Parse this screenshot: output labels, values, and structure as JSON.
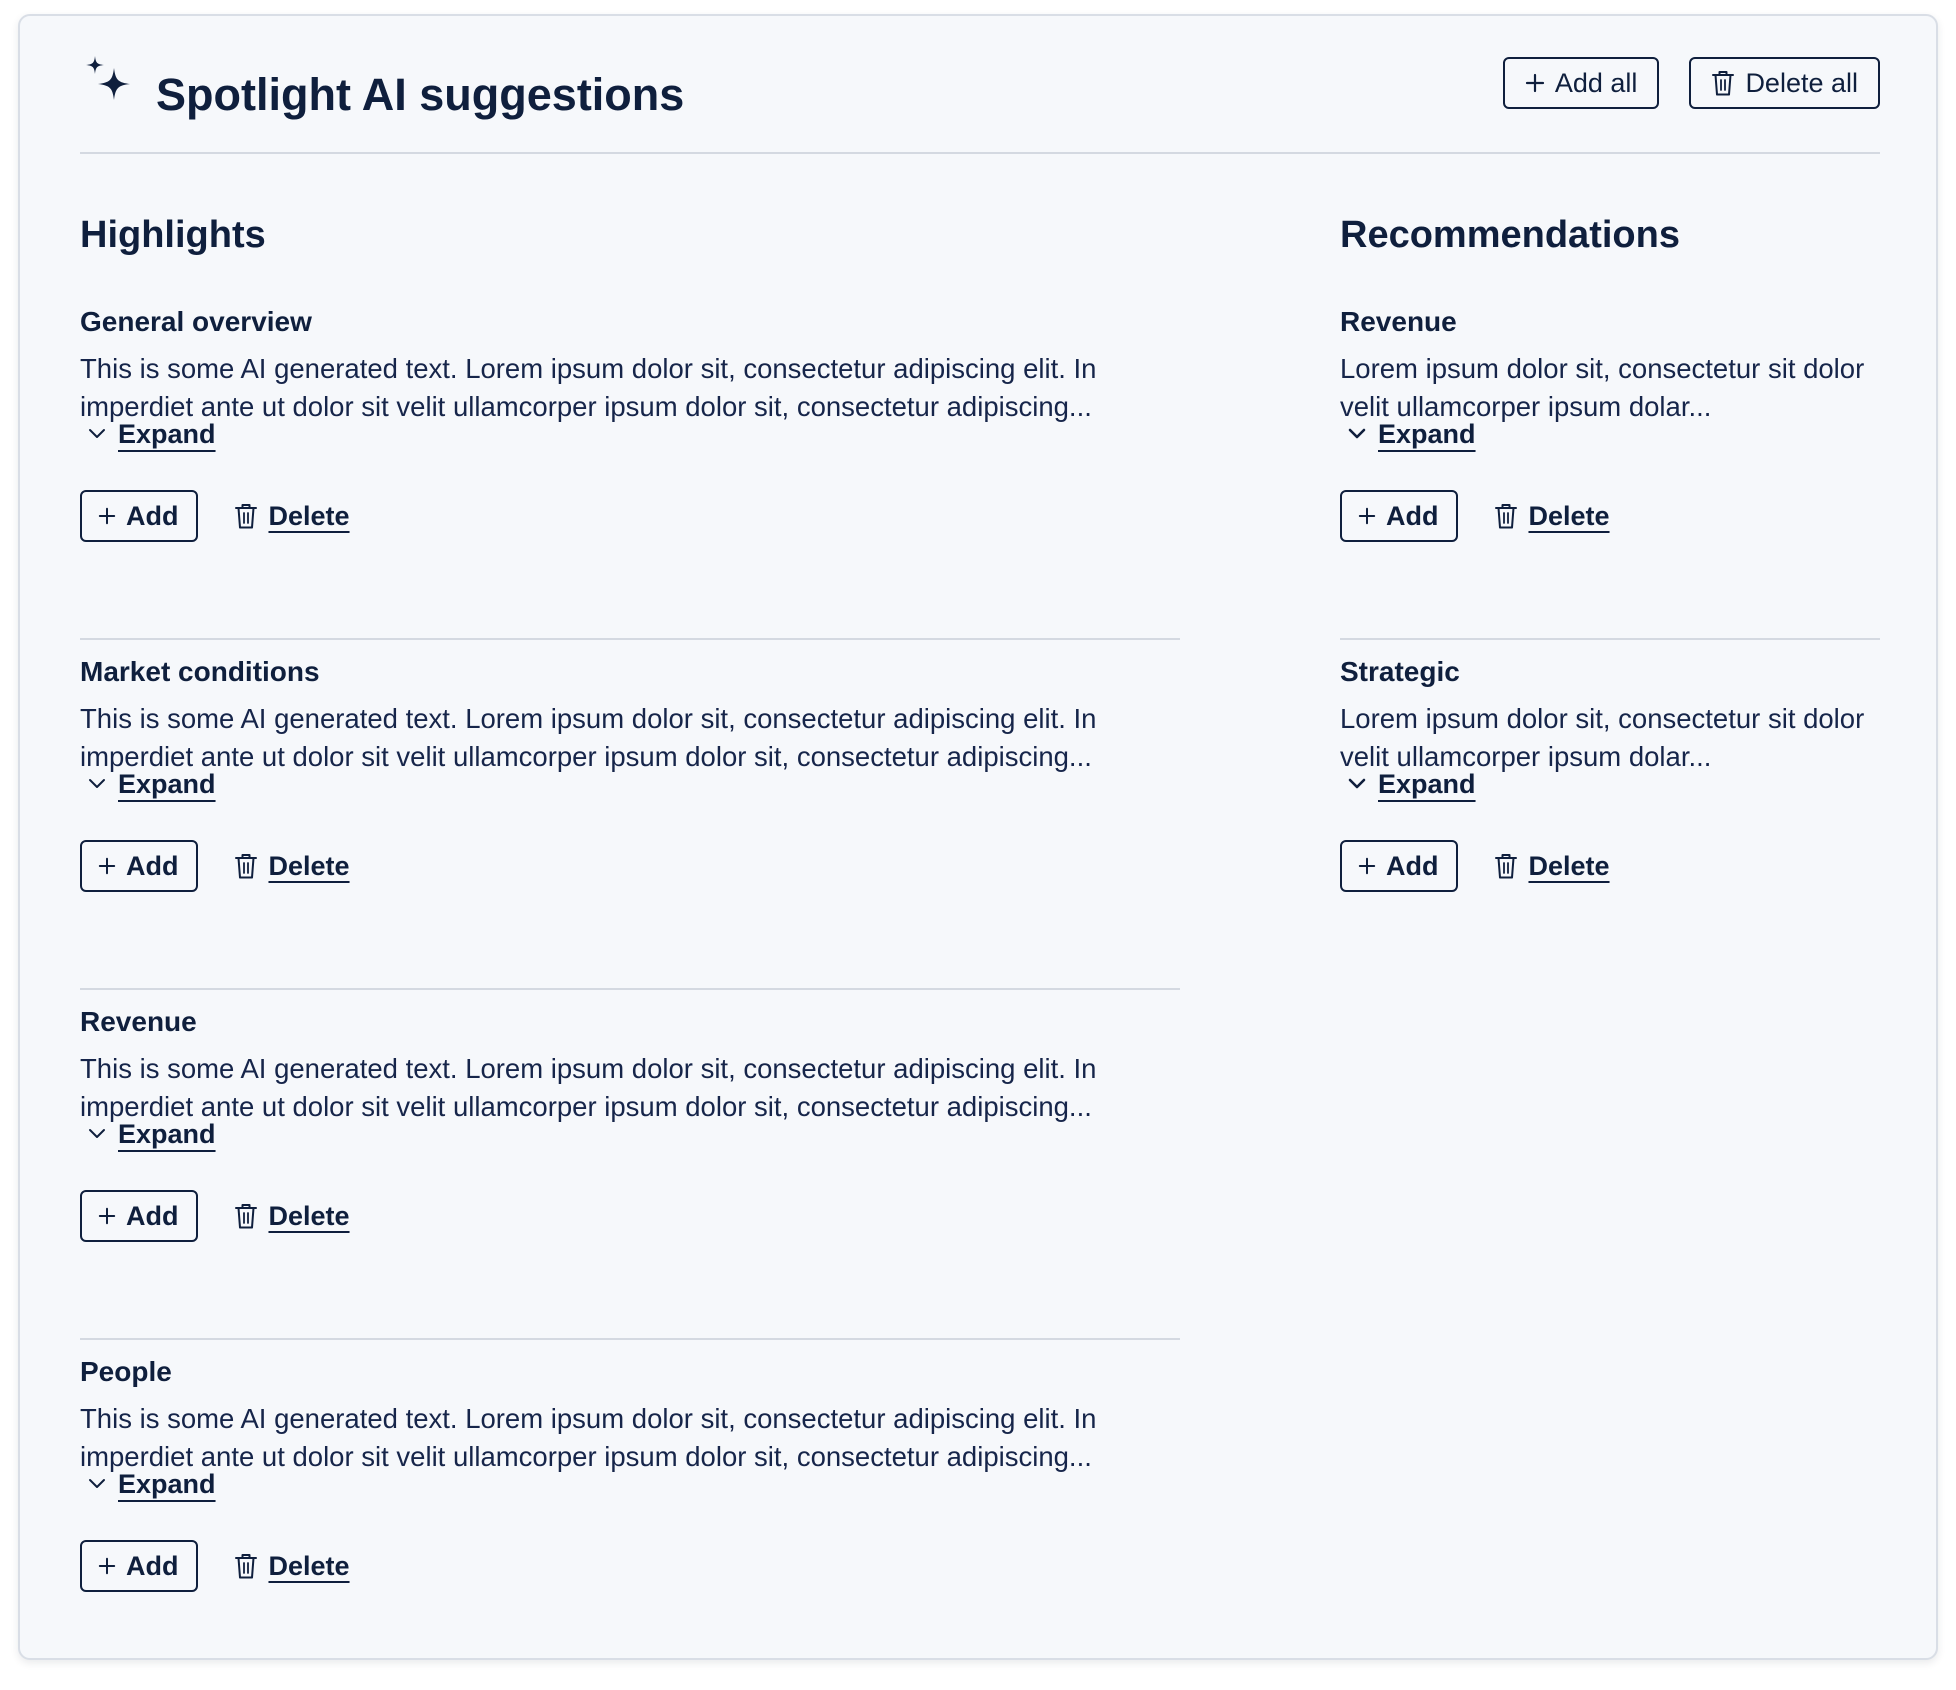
{
  "panel": {
    "title": "Spotlight AI suggestions",
    "title_icon": "sparkle-icon",
    "add_all_label": "Add all",
    "delete_all_label": "Delete all"
  },
  "highlights": {
    "heading": "Highlights",
    "items": [
      {
        "title": "General overview",
        "text": "This is some AI generated text. Lorem ipsum dolor sit, consectetur adipiscing elit. In imperdiet ante ut dolor sit velit ullamcorper ipsum dolor sit, consectetur adipiscing...",
        "expand_label": "Expand",
        "add_label": "Add",
        "delete_label": "Delete"
      },
      {
        "title": "Market conditions",
        "text": "This is some AI generated text. Lorem ipsum dolor sit, consectetur adipiscing elit. In imperdiet ante ut dolor sit velit ullamcorper ipsum dolor sit, consectetur adipiscing...",
        "expand_label": "Expand",
        "add_label": "Add",
        "delete_label": "Delete"
      },
      {
        "title": "Revenue",
        "text": "This is some AI generated text. Lorem ipsum dolor sit, consectetur adipiscing elit. In imperdiet ante ut dolor sit velit ullamcorper ipsum dolor sit, consectetur adipiscing...",
        "expand_label": "Expand",
        "add_label": "Add",
        "delete_label": "Delete"
      },
      {
        "title": "People",
        "text": "This is some AI generated text. Lorem ipsum dolor sit, consectetur adipiscing elit. In imperdiet ante ut dolor sit velit ullamcorper ipsum dolor sit, consectetur adipiscing...",
        "expand_label": "Expand",
        "add_label": "Add",
        "delete_label": "Delete"
      }
    ]
  },
  "recommendations": {
    "heading": "Recommendations",
    "items": [
      {
        "title": "Revenue",
        "text": "Lorem ipsum dolor sit, consectetur sit dolor velit ullamcorper ipsum dolar...",
        "expand_label": "Expand",
        "add_label": "Add",
        "delete_label": "Delete"
      },
      {
        "title": "Strategic",
        "text": "Lorem ipsum dolor sit, consectetur sit dolor velit ullamcorper ipsum dolar...",
        "expand_label": "Expand",
        "add_label": "Add",
        "delete_label": "Delete"
      }
    ]
  },
  "colors": {
    "text": "#0f1f3d",
    "panel_background": "#f6f8fb",
    "divider": "#d4d9e1"
  }
}
